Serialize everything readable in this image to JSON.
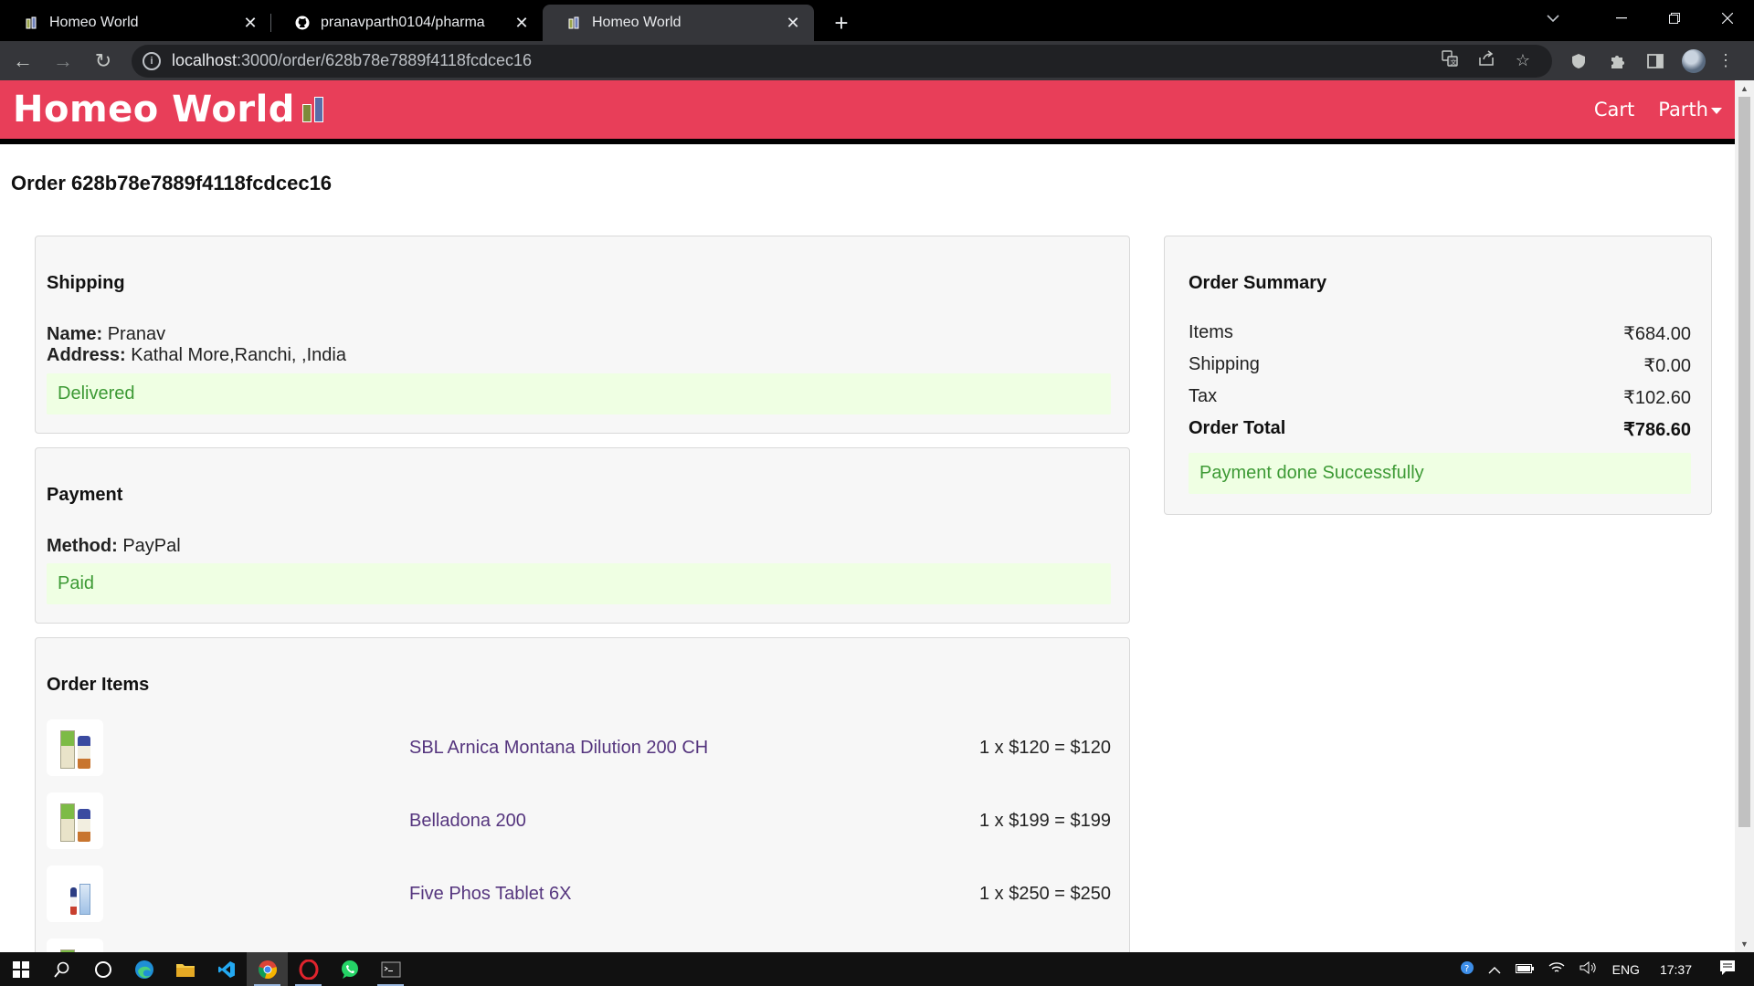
{
  "browser": {
    "tabs": [
      {
        "title": "Homeo World",
        "icon": "pharmacy-favicon-icon",
        "active": false
      },
      {
        "title": "pranavparth0104/pharma",
        "icon": "github-icon",
        "active": false
      },
      {
        "title": "Homeo World",
        "icon": "pharmacy-favicon-icon",
        "active": true
      }
    ],
    "url_host": "localhost",
    "url_path": ":3000/order/628b78e7889f4118fcdcec16"
  },
  "app": {
    "brand": "Homeo World",
    "nav": {
      "cart": "Cart",
      "user": "Parth"
    }
  },
  "order": {
    "title": "Order 628b78e7889f4118fcdcec16",
    "shipping": {
      "heading": "Shipping",
      "name_label": "Name:",
      "name": "Pranav",
      "address_label": "Address:",
      "address": "Kathal More,Ranchi, ,India",
      "status": "Delivered"
    },
    "payment": {
      "heading": "Payment",
      "method_label": "Method:",
      "method": "PayPal",
      "status": "Paid"
    },
    "items": {
      "heading": "Order Items",
      "list": [
        {
          "name": "SBL Arnica Montana Dilution 200 CH",
          "price": "1 x $120 = $120"
        },
        {
          "name": "Belladona 200",
          "price": "1 x $199 = $199"
        },
        {
          "name": "Five Phos Tablet 6X",
          "price": "1 x $250 = $250"
        }
      ]
    },
    "summary": {
      "heading": "Order Summary",
      "rows": [
        {
          "label": "Items",
          "value": "₹684.00"
        },
        {
          "label": "Shipping",
          "value": "₹0.00"
        },
        {
          "label": "Tax",
          "value": "₹102.60"
        },
        {
          "label": "Order Total",
          "value": "₹786.60"
        }
      ],
      "status": "Payment done Successfully"
    }
  },
  "taskbar": {
    "lang": "ENG",
    "time": "17:37"
  },
  "colors": {
    "navbar": "#e83e59",
    "alert_bg": "#efffe3",
    "alert_text": "#3d9a35",
    "link": "#55357e"
  }
}
